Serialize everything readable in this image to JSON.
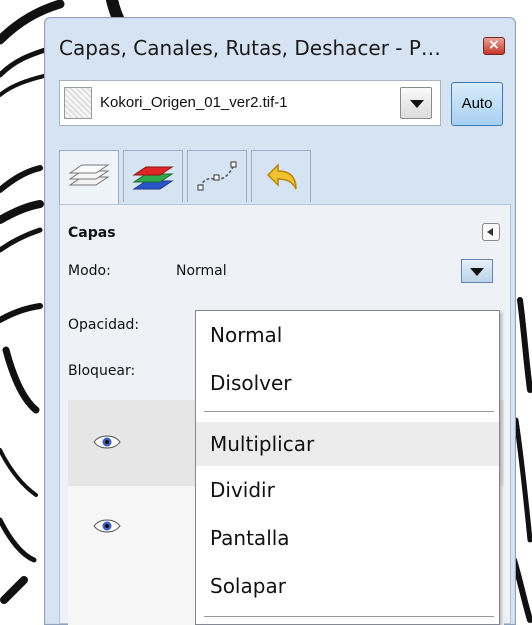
{
  "window": {
    "title": "Capas, Canales, Rutas, Deshacer - P…",
    "close_icon": "close-icon"
  },
  "image_selector": {
    "value": "Kokori_Origen_01_ver2.tif-1",
    "auto_label": "Auto"
  },
  "tabs": [
    {
      "name": "layers",
      "icon": "layers-icon"
    },
    {
      "name": "channels",
      "icon": "channels-icon"
    },
    {
      "name": "paths",
      "icon": "paths-icon"
    },
    {
      "name": "undo",
      "icon": "undo-icon"
    }
  ],
  "panel": {
    "title": "Capas",
    "mode_label": "Modo:",
    "mode_value": "Normal",
    "opacity_label": "Opacidad:",
    "lock_label": "Bloquear:"
  },
  "mode_menu": {
    "items": [
      "Normal",
      "Disolver",
      "Multiplicar",
      "Dividir",
      "Pantalla",
      "Solapar"
    ],
    "hovered": "Multiplicar"
  },
  "colors": {
    "accent": "#a7d0f1",
    "window_bg": "#d6e3f2",
    "close": "#c2372a"
  }
}
